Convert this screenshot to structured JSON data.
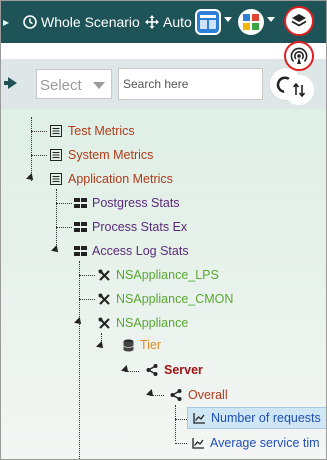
{
  "toolbar": {
    "scope_label": "Whole Scenario",
    "auto_label": "Auto"
  },
  "filter": {
    "select_value": "Select",
    "search_placeholder": "Search here"
  },
  "tree": {
    "nodes": [
      {
        "label": "Test Metrics",
        "icon": "list-icon",
        "color": "#b03a1a"
      },
      {
        "label": "System Metrics",
        "icon": "list-icon",
        "color": "#b03a1a"
      },
      {
        "label": "Application Metrics",
        "icon": "list-icon",
        "color": "#b03a1a"
      },
      {
        "label": "Postgress Stats",
        "icon": "group-icon",
        "color": "#5a2a7a"
      },
      {
        "label": "Process Stats Ex",
        "icon": "group-icon",
        "color": "#5a2a7a"
      },
      {
        "label": "Access Log Stats",
        "icon": "group-icon",
        "color": "#5a2a7a"
      },
      {
        "label": "NSAppliance_LPS",
        "icon": "tools-icon",
        "color": "#5aa632"
      },
      {
        "label": "NSAppliance_CMON",
        "icon": "tools-icon",
        "color": "#5aa632"
      },
      {
        "label": "NSAppliance",
        "icon": "tools-icon",
        "color": "#5aa632"
      },
      {
        "label": "Tier",
        "icon": "database-icon",
        "color": "#e08a20"
      },
      {
        "label": "Server",
        "icon": "share-icon",
        "color": "#a01515"
      },
      {
        "label": "Overall",
        "icon": "share-icon",
        "color": "#b03a1a"
      },
      {
        "label": "Number of requests",
        "icon": "chart-icon",
        "color": "#1f4fb8"
      },
      {
        "label": "Average service tim",
        "icon": "chart-icon",
        "color": "#1f4fb8"
      }
    ]
  }
}
